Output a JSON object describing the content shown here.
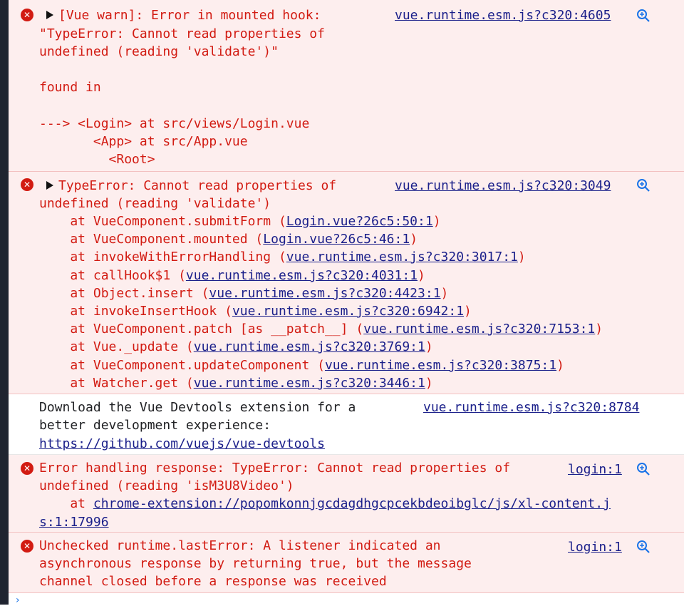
{
  "messages": [
    {
      "lines": [
        "[Vue warn]: Error in mounted hook:",
        "\"TypeError: Cannot read properties of",
        "undefined (reading 'validate')\"",
        "",
        "found in",
        "",
        "---> <Login> at src/views/Login.vue",
        "       <App> at src/App.vue",
        "         <Root>"
      ],
      "source": "vue.runtime.esm.js?c320:4605"
    },
    {
      "lines": [
        "TypeError: Cannot read properties of",
        "undefined (reading 'validate')"
      ],
      "source": "vue.runtime.esm.js?c320:3049",
      "stack": [
        {
          "prefix": "    at VueComponent.submitForm (",
          "link": "Login.vue?26c5:50:1",
          "suffix": ")"
        },
        {
          "prefix": "    at VueComponent.mounted (",
          "link": "Login.vue?26c5:46:1",
          "suffix": ")"
        },
        {
          "prefix": "    at invokeWithErrorHandling (",
          "link": "vue.runtime.esm.js?c320:3017:1",
          "suffix": ")"
        },
        {
          "prefix": "    at callHook$1 (",
          "link": "vue.runtime.esm.js?c320:4031:1",
          "suffix": ")"
        },
        {
          "prefix": "    at Object.insert (",
          "link": "vue.runtime.esm.js?c320:4423:1",
          "suffix": ")"
        },
        {
          "prefix": "    at invokeInsertHook (",
          "link": "vue.runtime.esm.js?c320:6942:1",
          "suffix": ")"
        },
        {
          "prefix": "    at VueComponent.patch [as __patch__] (",
          "link": "vue.runtime.esm.js?c320:7153:1",
          "suffix": ")"
        },
        {
          "prefix": "    at Vue._update (",
          "link": "vue.runtime.esm.js?c320:3769:1",
          "suffix": ")"
        },
        {
          "prefix": "    at VueComponent.updateComponent (",
          "link": "vue.runtime.esm.js?c320:3875:1",
          "suffix": ")"
        },
        {
          "prefix": "    at Watcher.get (",
          "link": "vue.runtime.esm.js?c320:3446:1",
          "suffix": ")"
        }
      ]
    },
    {
      "lines": [
        "Download the Vue Devtools extension for a",
        "better development experience:"
      ],
      "link": "https://github.com/vuejs/vue-devtools",
      "source": "vue.runtime.esm.js?c320:8784"
    },
    {
      "lines": [
        "Error handling response: TypeError: Cannot read properties of",
        "undefined (reading 'isM3U8Video')"
      ],
      "at_prefix": "    at ",
      "link_part1": "chrome-extension://popomkonnjgcdagdhgcpcekbdeoibglc/js/xl-content.j",
      "link_part2": "s:1:17996",
      "source": "login:1"
    },
    {
      "lines": [
        "Unchecked runtime.lastError: A listener indicated an",
        "asynchronous response by returning true, but the message",
        "channel closed before a response was received"
      ],
      "source": "login:1"
    }
  ],
  "icons": {
    "error": "error-circle-icon",
    "expand": "triangle-right-icon",
    "search": "magnifier-icon",
    "prompt": "chevron-right-icon"
  },
  "colors": {
    "error_text": "#d21b12",
    "error_bg": "#fdeeee",
    "link": "#1a1f8a",
    "gutter": "#1f2430"
  }
}
